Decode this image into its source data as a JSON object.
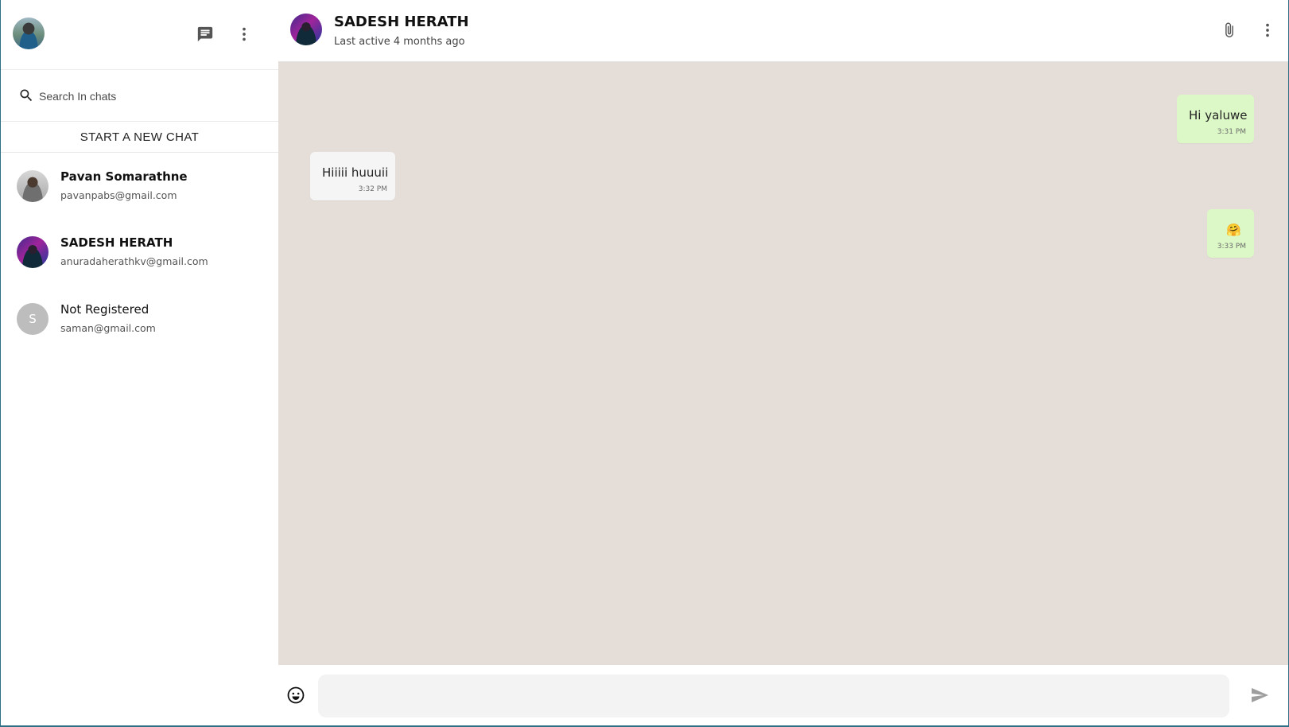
{
  "sidebar": {
    "search": {
      "placeholder": "Search In chats"
    },
    "new_chat_label": "START A NEW CHAT",
    "chats": [
      {
        "name": "Pavan Somarathne",
        "email": "pavanpabs@gmail.com",
        "bold": true
      },
      {
        "name": "SADESH HERATH",
        "email": "anuradaherathkv@gmail.com",
        "bold": true
      },
      {
        "name": "Not Registered",
        "email": "saman@gmail.com",
        "initial": "S",
        "bold": false
      }
    ],
    "icons": [
      "avatar",
      "new-chat-icon",
      "more-vert-icon",
      "search-icon"
    ]
  },
  "chat": {
    "contact_name": "SADESH HERATH",
    "status": "Last active 4 months ago",
    "messages": [
      {
        "direction": "out",
        "text": "Hi yaluwe",
        "time": "3:31 PM"
      },
      {
        "direction": "in",
        "text": "Hiiiii huuuii",
        "time": "3:32 PM"
      },
      {
        "direction": "out",
        "text": "🤗",
        "time": "3:33 PM"
      }
    ],
    "input": {
      "value": "",
      "placeholder": ""
    },
    "icons": [
      "attach-icon",
      "more-vert-icon",
      "emoji-icon",
      "send-icon"
    ]
  },
  "colors": {
    "outgoing_bubble": "#dcf8c6",
    "incoming_bubble": "#f5f5f5",
    "chat_background": "#e4ddd8",
    "frame_border": "#2f6f86"
  }
}
